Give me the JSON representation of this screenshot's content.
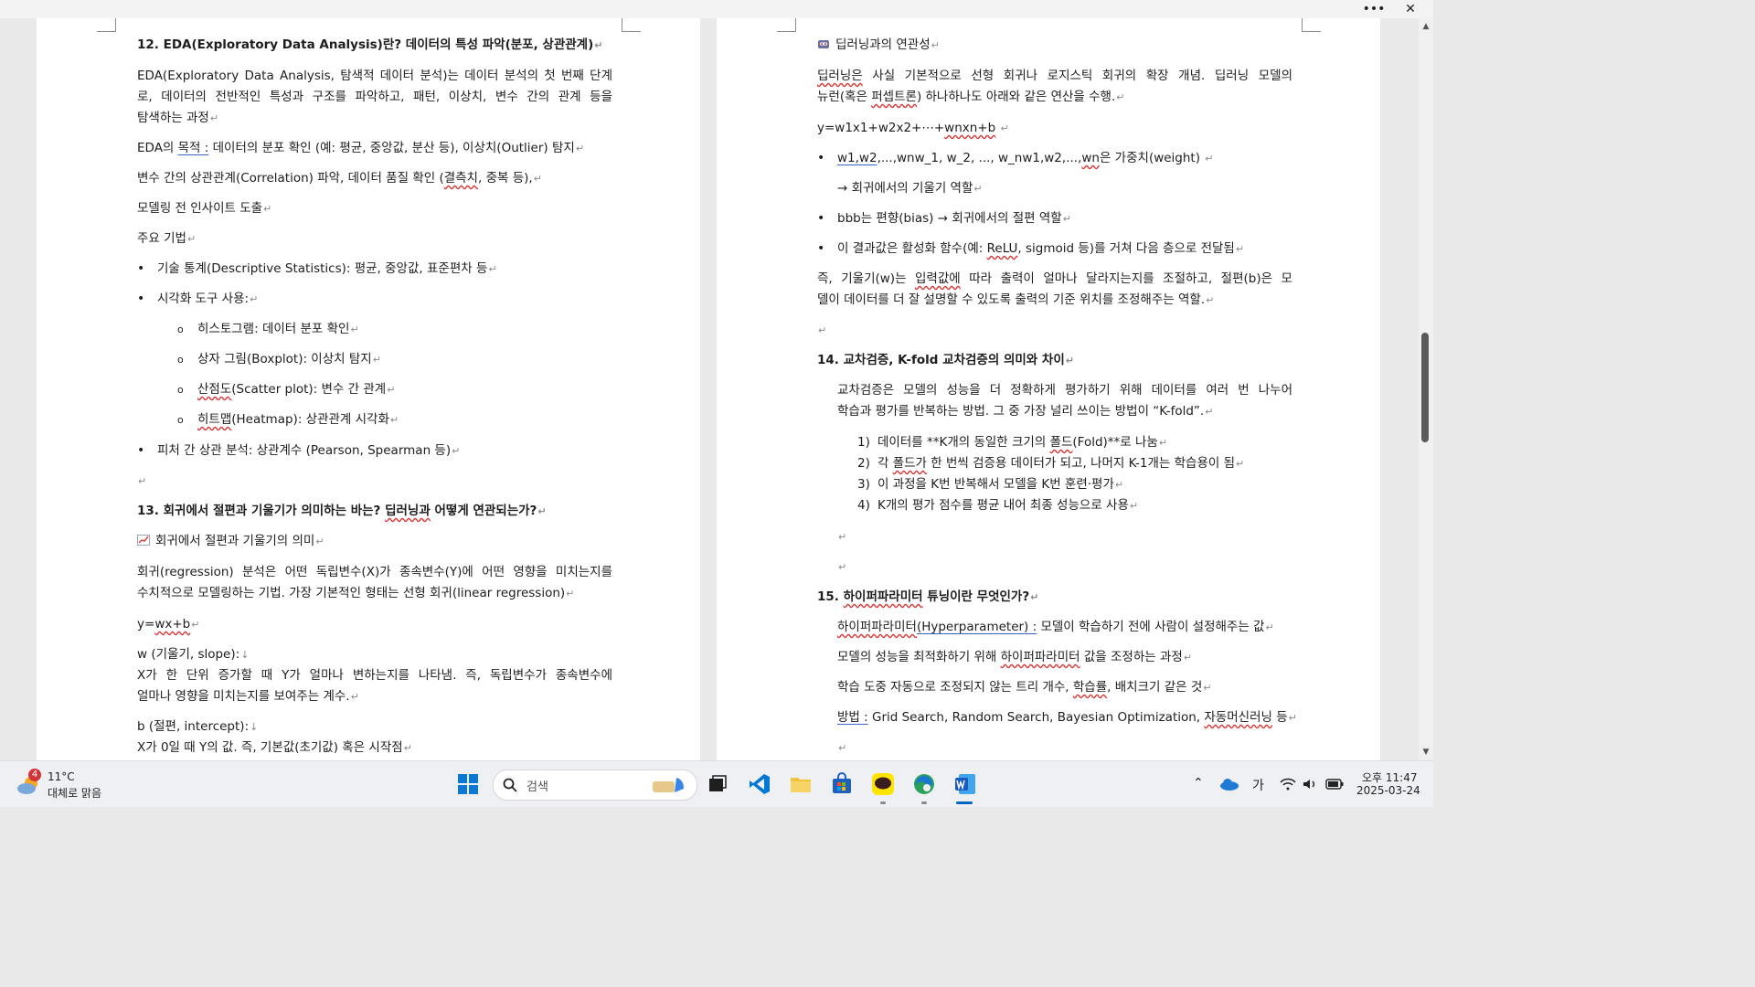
{
  "window": {
    "menu_label": "•••",
    "close_label": "✕"
  },
  "left": {
    "h12": "12. EDA(Exploratory Data Analysis)란? 데이터의 특성 파악(분포, 상관관계)",
    "p1": [
      "EDA(Exploratory Data Analysis, 탐색적 데이터 분석)는 데이터 분석의 첫 번째 단계",
      "로, 데이터의 전반적인 특성과 구조를 파악하고, 패턴, 이상치, 변수 간의 관계 등을",
      "탐색하는 과정"
    ],
    "p2_a": "EDA의 ",
    "p2_b": "목적 :",
    "p2_c": " 데이터의 분포 확인 (예: 평균, 중앙값, 분산 등), 이상치(Outlier) 탐지",
    "p3_a": "변수 간의 상관관계(Correlation) 파악, 데이터 품질 확인 (",
    "p3_b": "결측치",
    "p3_c": ", 중복 등),",
    "p4": "모델링 전 인사이트 도출",
    "p5": "주요 기법",
    "b1": "기술 통계(Descriptive Statistics): 평균, 중앙값, 표준편차 등",
    "b2": "시각화 도구 사용:",
    "s1": "히스토그램: 데이터 분포 확인",
    "s2": "상자 그림(Boxplot): 이상치 탐지",
    "s3_a": "산점도",
    "s3_b": "(Scatter plot): 변수 간 관계",
    "s4_a": "히트맵",
    "s4_b": "(Heatmap): 상관관계 시각화",
    "b3": "피처 간 상관 분석: 상관계수 (Pearson, Spearman 등)",
    "h13_a": "13. 회귀에서 절편과 기울기가 의미하는 바는? ",
    "h13_b": "딥러닝과",
    "h13_c": " 어떻게 연관되는가?",
    "sub13": "회귀에서 절편과 기울기의 의미",
    "p6": [
      "회귀(regression) 분석은 어떤 독립변수(X)가 종속변수(Y)에 어떤 영향을 미치는지를",
      "수치적으로 모델링하는 기법. 가장 기본적인 형태는 선형 회귀(linear regression)"
    ],
    "eq1_a": "y=",
    "eq1_b": "wx+b",
    "w_def": "w (기울기, slope):",
    "w_desc": [
      "X가 한 단위 증가할 때 Y가 얼마나 변하는지를 나타냄. 즉, 독립변수가 종속변수에",
      "얼마나 영향을 미치는지를 보여주는 계수."
    ],
    "b_def": "b (절편, intercept):",
    "b_desc": "X가 0일 때 Y의 값. 즉, 기본값(초기값) 혹은 시작점"
  },
  "right": {
    "sub_dl": "딥러닝과의 연관성",
    "p1_a": "",
    "p1_b": "딥러닝은",
    "p1_c": " 사실 기본적으로 선형 회귀나 로지스틱 회귀의 확장 개념. 딥러닝 모델의",
    "p1_d": "뉴런(혹은 ",
    "p1_e": "퍼셉트론",
    "p1_f": ") 하나하나도 아래와 같은 연산을 수행.",
    "eq": "y=w1x1+w2x2+⋯+",
    "eq_b": "wnxn+b",
    "bl1_a": "w1,w2",
    "bl1_b": ",...,wnw_1, w_2, ..., w_nw1,w2,...,",
    "bl1_c": "wn",
    "bl1_d": "은 가중치(weight)",
    "bl1_e": "→ 회귀에서의 기울기 역할",
    "bl2": "bbb는 편향(bias) → 회귀에서의 절편 역할",
    "bl3_a": "이 결과값은 활성화 함수(예: ",
    "bl3_b": "ReLU",
    "bl3_c": ", sigmoid 등)를 거쳐 다음 층으로 전달됨",
    "p2_a": "즉, 기울기(w)는 ",
    "p2_b": "입력값에",
    "p2_c": " 따라 출력이 얼마나 달라지는지를 조절하고, 절편(b)은 모",
    "p2_d": "델이 데이터를 더 잘 설명할 수 있도록 출력의 기준 위치를 조정해주는 역할.",
    "h14": "14. 교차검증, K-fold 교차검증의 의미와 차이",
    "p3": [
      "교차검증은 모델의 성능을 더 정확하게 평가하기 위해 데이터를 여러 번 나누어",
      "학습과 평가를 반복하는 방법. 그 중 가장 널리 쓰이는 방법이 “K-fold”."
    ],
    "n1_a": "데이터를 **K개의 동일한 크기의 ",
    "n1_b": "폴드",
    "n1_c": "(Fold)**로 나눔",
    "n2_a": "각 ",
    "n2_b": "폴드가",
    "n2_c": " 한 번씩 검증용 데이터가 되고, 나머지 K-1개는 학습용이 됨",
    "n3": "이 과정을 K번 반복해서 모델을 K번 훈련·평가",
    "n4": "K개의 평가 점수를 평균 내어 최종 성능으로 사용",
    "nums": [
      "1)",
      "2)",
      "3)",
      "4)"
    ],
    "h15_a": "15. ",
    "h15_b": "하이퍼파라미터",
    "h15_c": " 튜닝이란 무엇인가?",
    "q1_a": "하이퍼파라미터",
    "q1_b": "(Hyperparameter) :",
    "q1_c": " 모델이 학습하기 전에 사람이 설정해주는 값",
    "q2_a": "모델의 성능을 최적화하기 위해 ",
    "q2_b": "하이퍼파라미터",
    "q2_c": " 값을 조정하는 과정",
    "q3_a": "학습 도중 자동으로 조정되지 않는 트리 개수, ",
    "q3_b": "학습률",
    "q3_c": ", 배치크기 같은 것",
    "q4_a": "방법 :",
    "q4_b": " Grid Search, Random Search, Bayesian Optimization, ",
    "q4_c": "자동머신러닝",
    "q4_d": " 등"
  },
  "taskbar": {
    "weather_temp": "11°C",
    "weather_desc": "대체로 맑음",
    "weather_badge": "4",
    "search_placeholder": "검색",
    "ime": "가",
    "time": "오후 11:47",
    "date": "2025-03-24"
  },
  "marks": {
    "para": "↵",
    "linebreak": "↓"
  },
  "colors": {
    "accent": "#0067c0",
    "word_blue": "#185abd",
    "vscode": "#0078d4",
    "kakao": "#fee500"
  }
}
